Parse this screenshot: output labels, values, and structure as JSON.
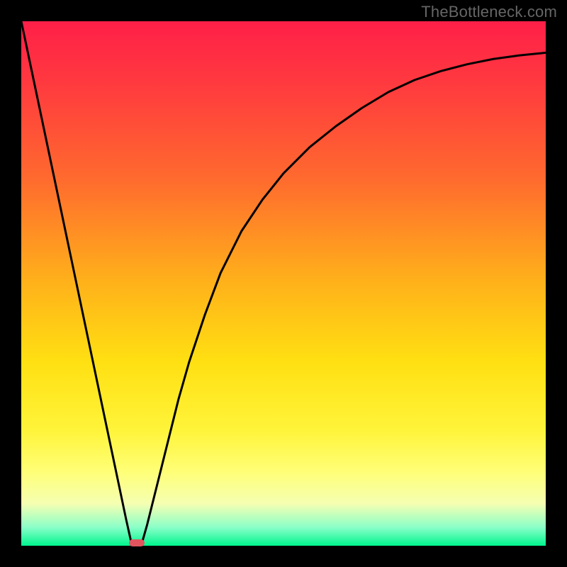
{
  "watermark": "TheBottleneck.com",
  "chart_data": {
    "type": "line",
    "title": "",
    "xlabel": "",
    "ylabel": "",
    "xlim": [
      0,
      100
    ],
    "ylim": [
      0,
      100
    ],
    "grid": false,
    "legend": false,
    "background_gradient_stops": [
      {
        "offset": 0.0,
        "color": "#ff1f48"
      },
      {
        "offset": 0.12,
        "color": "#ff3a3f"
      },
      {
        "offset": 0.3,
        "color": "#ff6a2e"
      },
      {
        "offset": 0.5,
        "color": "#ffb21a"
      },
      {
        "offset": 0.65,
        "color": "#ffe012"
      },
      {
        "offset": 0.78,
        "color": "#fff43a"
      },
      {
        "offset": 0.86,
        "color": "#ffff78"
      },
      {
        "offset": 0.92,
        "color": "#f5ffb2"
      },
      {
        "offset": 0.965,
        "color": "#8affc8"
      },
      {
        "offset": 1.0,
        "color": "#00f58e"
      }
    ],
    "series": [
      {
        "name": "bottleneck-curve",
        "x": [
          0,
          2,
          4,
          6,
          8,
          10,
          12,
          14,
          16,
          18,
          20,
          21,
          22,
          23,
          24,
          26,
          28,
          30,
          32,
          35,
          38,
          42,
          46,
          50,
          55,
          60,
          65,
          70,
          75,
          80,
          85,
          90,
          95,
          100
        ],
        "y": [
          100,
          90.5,
          81,
          71.5,
          62,
          52.5,
          43,
          33.5,
          24,
          14.5,
          5,
          0.5,
          0,
          0.5,
          4,
          12,
          20,
          28,
          35,
          44,
          52,
          60,
          66,
          71,
          76,
          80,
          83.5,
          86.5,
          88.8,
          90.5,
          91.8,
          92.8,
          93.5,
          94
        ]
      }
    ],
    "marker": {
      "name": "optimal-point",
      "x": 22,
      "y": 0,
      "color": "#e2555f"
    }
  }
}
